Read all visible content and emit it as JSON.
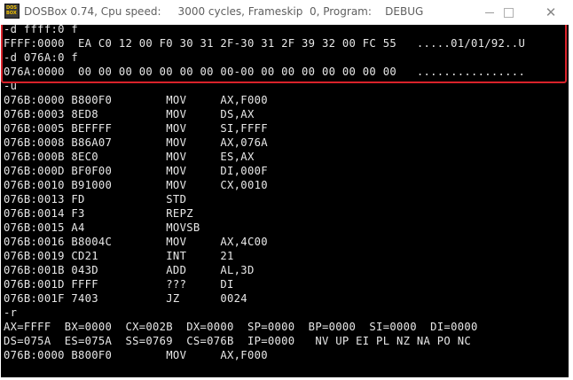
{
  "window": {
    "title": "DOSBox 0.74, Cpu speed:     3000 cycles, Frameskip  0, Program:    DEBUG",
    "icon": "dosbox-app-icon",
    "icon_text": [
      "DOS",
      "BOX"
    ]
  },
  "controls": {
    "minimize": "minimize-icon",
    "maximize": "maximize-icon",
    "close": "close-icon",
    "close_glyph": "✕"
  },
  "console": {
    "lines": [
      "-d ffff:0 f",
      "FFFF:0000  EA C0 12 00 F0 30 31 2F-30 31 2F 39 32 00 FC 55   .....01/01/92..U",
      "-d 076A:0 f",
      "076A:0000  00 00 00 00 00 00 00 00-00 00 00 00 00 00 00 00   ................",
      "-u",
      "076B:0000 B800F0        MOV     AX,F000",
      "076B:0003 8ED8          MOV     DS,AX",
      "076B:0005 BEFFFF        MOV     SI,FFFF",
      "076B:0008 B86A07        MOV     AX,076A",
      "076B:000B 8EC0          MOV     ES,AX",
      "076B:000D BF0F00        MOV     DI,000F",
      "076B:0010 B91000        MOV     CX,0010",
      "076B:0013 FD            STD",
      "076B:0014 F3            REPZ",
      "076B:0015 A4            MOVSB",
      "076B:0016 B8004C        MOV     AX,4C00",
      "076B:0019 CD21          INT     21",
      "076B:001B 043D          ADD     AL,3D",
      "076B:001D FFFF          ???     DI",
      "076B:001F 7403          JZ      0024",
      "-r",
      "AX=FFFF  BX=0000  CX=002B  DX=0000  SP=0000  BP=0000  SI=0000  DI=0000",
      "DS=075A  ES=075A  SS=0769  CS=076B  IP=0000   NV UP EI PL NZ NA PO NC",
      "076B:0000 B800F0        MOV     AX,F000"
    ]
  },
  "colors": {
    "highlight_border": "#d9222a",
    "console_bg": "#000000",
    "console_text": "#e8e8e8"
  }
}
